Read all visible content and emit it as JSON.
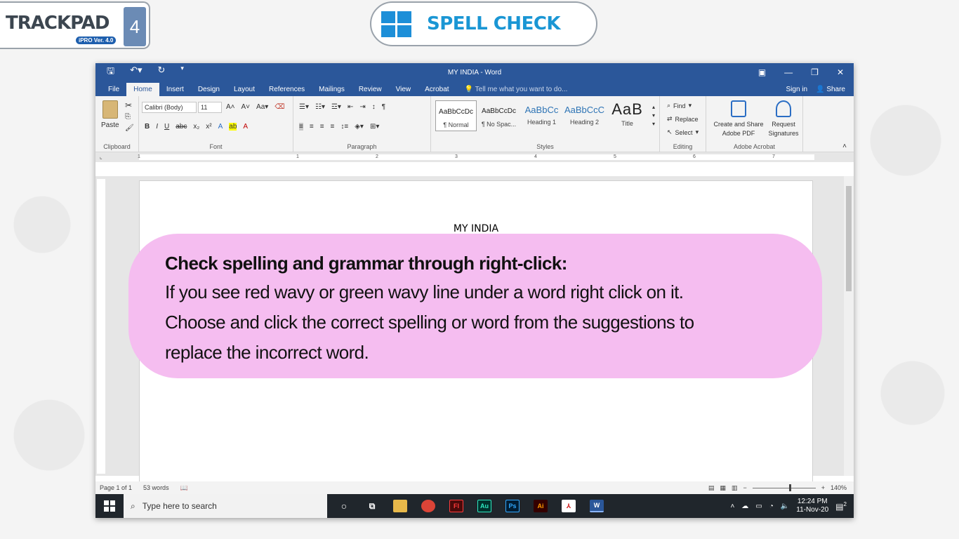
{
  "branding": {
    "logo_text": "TRACKPAD",
    "logo_version": "iPRO Ver. 4.0",
    "logo_number": "4",
    "topic_title": "SPELL CHECK"
  },
  "word": {
    "window_title": "MY INDIA - Word",
    "tabs": [
      "File",
      "Home",
      "Insert",
      "Design",
      "Layout",
      "References",
      "Mailings",
      "Review",
      "View",
      "Acrobat"
    ],
    "active_tab": "Home",
    "tell_me": "Tell me what you want to do...",
    "sign_in": "Sign in",
    "share": "Share",
    "ribbon": {
      "clipboard": {
        "label": "Clipboard",
        "paste": "Paste"
      },
      "font": {
        "label": "Font",
        "font_name": "Calibri (Body)",
        "font_size": "11"
      },
      "paragraph": {
        "label": "Paragraph"
      },
      "styles": {
        "label": "Styles",
        "items": [
          {
            "sample": "AaBbCcDc",
            "name": "¶ Normal"
          },
          {
            "sample": "AaBbCcDc",
            "name": "¶ No Spac..."
          },
          {
            "sample": "AaBbCc",
            "name": "Heading 1"
          },
          {
            "sample": "AaBbCcC",
            "name": "Heading 2"
          },
          {
            "sample": "AaB",
            "name": "Title"
          }
        ]
      },
      "editing": {
        "label": "Editing",
        "find": "Find",
        "replace": "Replace",
        "select": "Select"
      },
      "acrobat": {
        "label": "Adobe Acrobat",
        "create_share_1": "Create and Share",
        "create_share_2": "Adobe PDF",
        "request_1": "Request",
        "request_2": "Signatures"
      }
    },
    "ruler_numbers": [
      "1",
      "1",
      "2",
      "3",
      "4",
      "5",
      "6",
      "7"
    ],
    "document_title": "MY INDIA",
    "status": {
      "page": "Page 1 of 1",
      "words": "53 words",
      "zoom": "140%"
    }
  },
  "taskbar": {
    "search_placeholder": "Type here to search",
    "time": "12:24 PM",
    "date": "11-Nov-20",
    "notifications": "2"
  },
  "callout": {
    "heading": "Check spelling and grammar through right-click:",
    "lines": [
      "If you see red wavy or green wavy line under a word right click on it.",
      "Choose and click the correct spelling or word from the suggestions to",
      "replace the incorrect word."
    ]
  },
  "colors": {
    "word_blue": "#2b579a",
    "callout_pink": "#f5bdf0",
    "title_blue": "#1a96d4"
  }
}
